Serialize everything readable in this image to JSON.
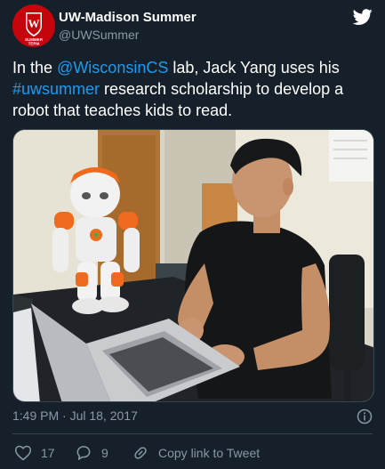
{
  "author": {
    "display_name": "UW-Madison Summer",
    "handle": "@UWSummer",
    "avatar_text": "SUMMER TERM"
  },
  "tweet": {
    "text_before": "In the ",
    "mention": "@WisconsinCS",
    "text_middle": " lab, Jack Yang uses his ",
    "hashtag": "#uwsummer",
    "text_after": " research scholarship to develop a robot that teaches kids to read."
  },
  "meta": {
    "timestamp": "1:49 PM · Jul 18, 2017"
  },
  "actions": {
    "like_count": "17",
    "reply_count": "9",
    "copy_link_label": "Copy link to Tweet"
  },
  "colors": {
    "background": "#15202b",
    "link": "#1d9bf0",
    "secondary_text": "#8b98a5",
    "avatar": "#c5050c"
  },
  "icons": [
    "twitter-bird-icon",
    "info-icon",
    "heart-icon",
    "reply-icon",
    "copy-link-icon"
  ]
}
